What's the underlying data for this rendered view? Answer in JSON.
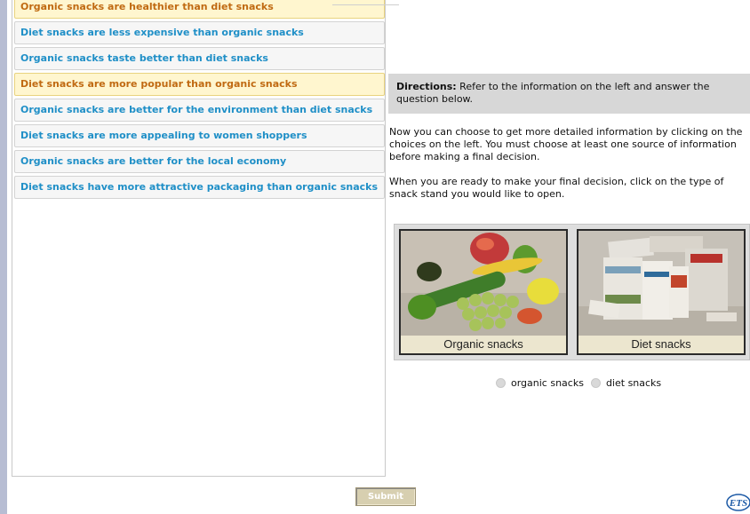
{
  "choices": [
    {
      "label": "Organic snacks are healthier than diet snacks",
      "selected": true
    },
    {
      "label": "Diet snacks are less expensive than organic snacks",
      "selected": false
    },
    {
      "label": "Organic snacks taste better than diet snacks",
      "selected": false
    },
    {
      "label": "Diet snacks are more popular than organic snacks",
      "selected": true
    },
    {
      "label": "Organic snacks are better for the environment than diet snacks",
      "selected": false
    },
    {
      "label": "Diet snacks are more appealing to women shoppers",
      "selected": false
    },
    {
      "label": "Organic snacks are better for the local economy",
      "selected": false
    },
    {
      "label": "Diet snacks have more attractive packaging than organic snacks",
      "selected": false
    }
  ],
  "directions": {
    "label": "Directions:",
    "text": " Refer to the information on the left and answer the question below."
  },
  "para1": "Now you can choose to get more detailed information by clicking on the choices on the left. You must choose at least one source of information before making a final decision.",
  "para2": "When you are ready to make your final decision, click on the type of snack stand you would like to open.",
  "stands": {
    "organic": {
      "caption": "Organic snacks",
      "radio_label": "organic snacks"
    },
    "diet": {
      "caption": "Diet snacks",
      "radio_label": "diet snacks"
    }
  },
  "submit_label": "Submit",
  "logo_text": "ETS",
  "colors": {
    "choice_text": "#1f8fc7",
    "choice_selected_text": "#c06a12",
    "choice_selected_bg": "#fff6cf",
    "directions_bg": "#d7d7d7",
    "submit_bg": "#d7cfb0",
    "logo_blue": "#1d5aa6"
  }
}
